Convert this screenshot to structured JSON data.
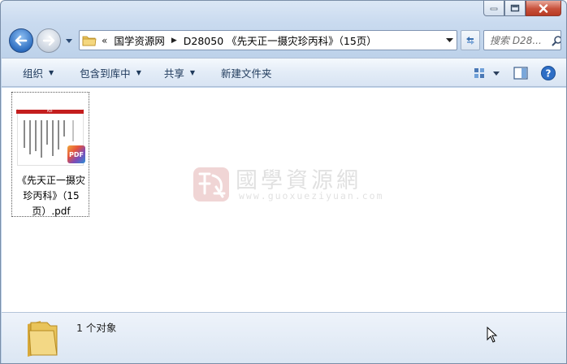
{
  "window": {
    "caption_buttons": [
      "minimize",
      "maximize",
      "close"
    ]
  },
  "nav": {
    "overflow_chevron": "«",
    "breadcrumbs": [
      "国学资源网",
      "D28050 《先天正一摄灾珍丙科》（15页）"
    ],
    "search_placeholder": "搜索 D28...",
    "icons": {
      "back": "back-arrow-icon",
      "forward": "forward-arrow-icon",
      "refresh": "refresh-icon",
      "search": "search-icon"
    }
  },
  "toolbar": {
    "organize": "组织",
    "include_in_library": "包含到库中",
    "share": "共享",
    "new_folder": "新建文件夹"
  },
  "files": [
    {
      "name": "《先天正一摄灾珍丙科》（15页）.pdf",
      "type": "pdf",
      "badge": "PDF"
    }
  ],
  "watermark": {
    "chinese": "國學資源網",
    "url": "www.guoxueziyuan.com"
  },
  "status": {
    "count_text": "1 个对象"
  },
  "colors": {
    "accent": "#1e395b",
    "pdf_red": "#c41e1e",
    "close_red": "#c7503a"
  }
}
